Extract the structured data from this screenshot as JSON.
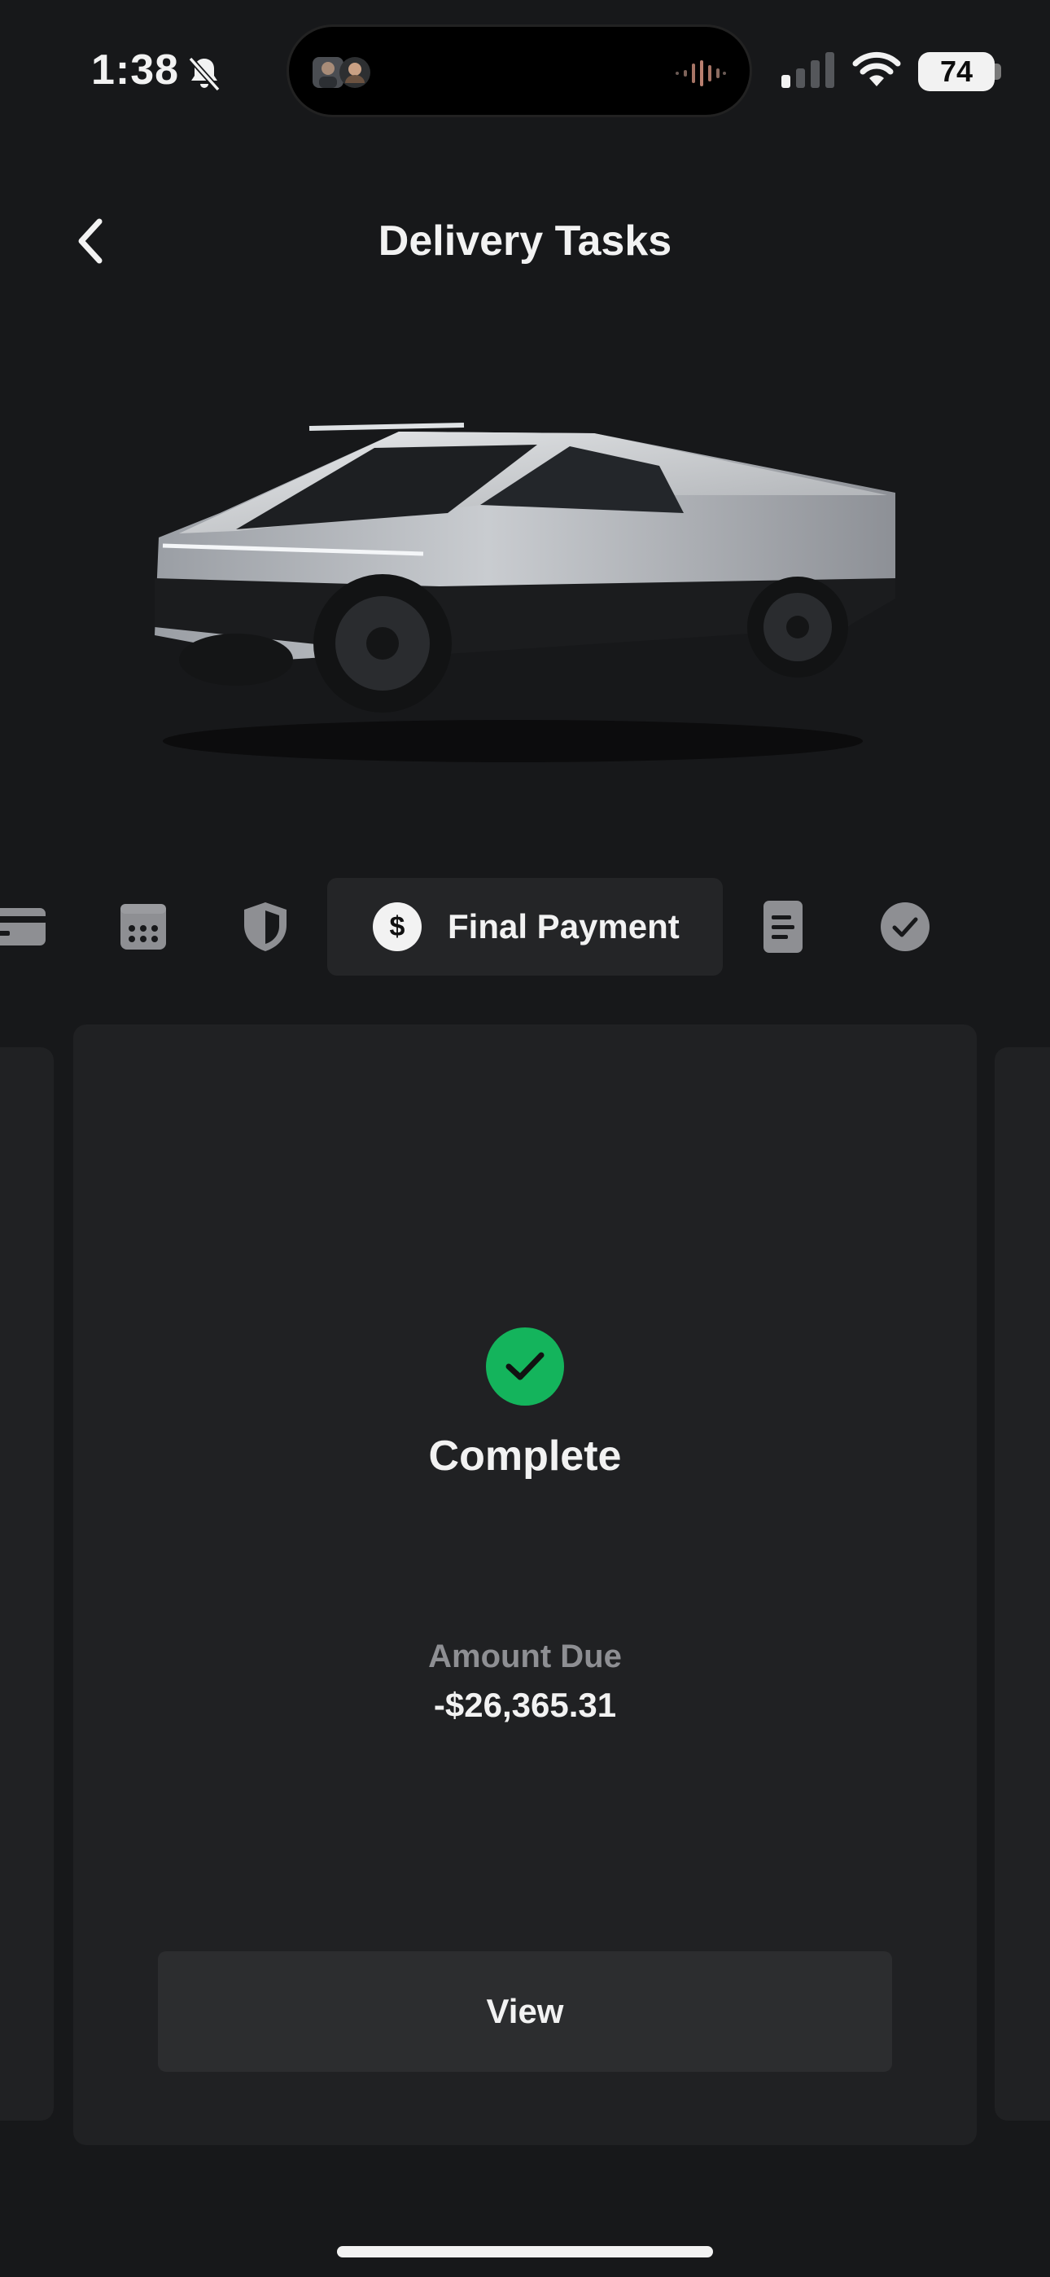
{
  "status_bar": {
    "time": "1:38",
    "battery_level": "74",
    "icons": [
      "bell-slash-icon",
      "waveform-icon",
      "cellular-signal-icon",
      "wifi-icon",
      "battery-icon"
    ]
  },
  "header": {
    "title": "Delivery Tasks",
    "back_icon": "chevron-left-icon"
  },
  "tabs": {
    "items": [
      {
        "icon": "credit-card-icon"
      },
      {
        "icon": "calendar-icon"
      },
      {
        "icon": "shield-icon"
      },
      {
        "icon": "dollar-icon",
        "label": "Final Payment",
        "active": true
      },
      {
        "icon": "document-icon"
      },
      {
        "icon": "checkmark-circle-icon"
      }
    ]
  },
  "task_card": {
    "status": "Complete",
    "amount_label": "Amount Due",
    "amount_value": "-$26,365.31",
    "button_label": "View"
  },
  "colors": {
    "background": "#17181a",
    "card": "#202123",
    "success": "#14b45c",
    "muted_text": "#8e8f93"
  }
}
